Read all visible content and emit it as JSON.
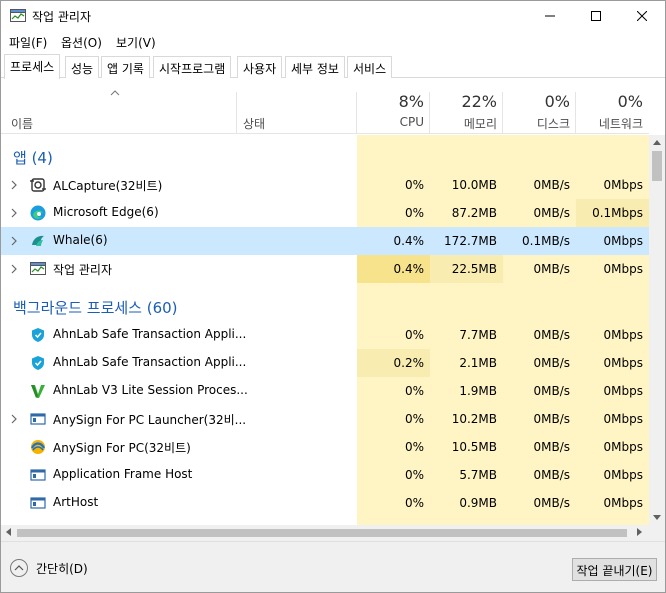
{
  "window": {
    "title": "작업 관리자",
    "minimize_icon": "minimize-icon",
    "maximize_icon": "maximize-icon",
    "close_icon": "close-icon"
  },
  "menu": [
    "파일(F)",
    "옵션(O)",
    "보기(V)"
  ],
  "tabs": [
    "프로세스",
    "성능",
    "앱 기록",
    "시작프로그램",
    "사용자",
    "세부 정보",
    "서비스"
  ],
  "active_tab": "프로세스",
  "columns": {
    "name": "이름",
    "status": "상태",
    "cpu": {
      "pct": "8%",
      "label": "CPU"
    },
    "memory": {
      "pct": "22%",
      "label": "메모리"
    },
    "disk": {
      "pct": "0%",
      "label": "디스크"
    },
    "network": {
      "pct": "0%",
      "label": "네트워크"
    }
  },
  "groups": {
    "apps": "앱 (4)",
    "background": "백그라운드 프로세스 (60)"
  },
  "apps": [
    {
      "name": "ALCapture(32비트)",
      "icon": "alcapture-icon",
      "cpu": "0%",
      "memory": "10.0MB",
      "disk": "0MB/s",
      "network": "0Mbps",
      "expandable": true
    },
    {
      "name": "Microsoft Edge(6)",
      "icon": "edge-icon",
      "cpu": "0%",
      "memory": "87.2MB",
      "disk": "0MB/s",
      "network": "0.1Mbps",
      "expandable": true
    },
    {
      "name": "Whale(6)",
      "icon": "whale-icon",
      "cpu": "0.4%",
      "memory": "172.7MB",
      "disk": "0.1MB/s",
      "network": "0Mbps",
      "expandable": true,
      "selected": true
    },
    {
      "name": "작업 관리자",
      "icon": "task-manager-icon",
      "cpu": "0.4%",
      "memory": "22.5MB",
      "disk": "0MB/s",
      "network": "0Mbps",
      "expandable": true
    }
  ],
  "background": [
    {
      "name": "AhnLab Safe Transaction Appli...",
      "icon": "shield-icon",
      "cpu": "0%",
      "memory": "7.7MB",
      "disk": "0MB/s",
      "network": "0Mbps",
      "expandable": false
    },
    {
      "name": "AhnLab Safe Transaction Appli...",
      "icon": "shield-icon",
      "cpu": "0.2%",
      "memory": "2.1MB",
      "disk": "0MB/s",
      "network": "0Mbps",
      "expandable": false
    },
    {
      "name": "AhnLab V3 Lite Session Proces...",
      "icon": "v3-icon",
      "cpu": "0%",
      "memory": "1.9MB",
      "disk": "0MB/s",
      "network": "0Mbps",
      "expandable": false
    },
    {
      "name": "AnySign For PC Launcher(32비...",
      "icon": "app-window-icon",
      "cpu": "0%",
      "memory": "10.2MB",
      "disk": "0MB/s",
      "network": "0Mbps",
      "expandable": true
    },
    {
      "name": "AnySign For PC(32비트)",
      "icon": "anysign-icon",
      "cpu": "0%",
      "memory": "10.5MB",
      "disk": "0MB/s",
      "network": "0Mbps",
      "expandable": false
    },
    {
      "name": "Application Frame Host",
      "icon": "app-window-icon",
      "cpu": "0%",
      "memory": "5.7MB",
      "disk": "0MB/s",
      "network": "0Mbps",
      "expandable": false
    },
    {
      "name": "ArtHost",
      "icon": "app-window-icon",
      "cpu": "0%",
      "memory": "0.9MB",
      "disk": "0MB/s",
      "network": "0Mbps",
      "expandable": false
    }
  ],
  "footer": {
    "fewer_details": "간단히(D)",
    "end_task": "작업 끝내기(E)"
  },
  "colors": {
    "group_title": "#1c5db5",
    "column_bg": "#fff4c4",
    "selected_row": "#cce8ff"
  }
}
